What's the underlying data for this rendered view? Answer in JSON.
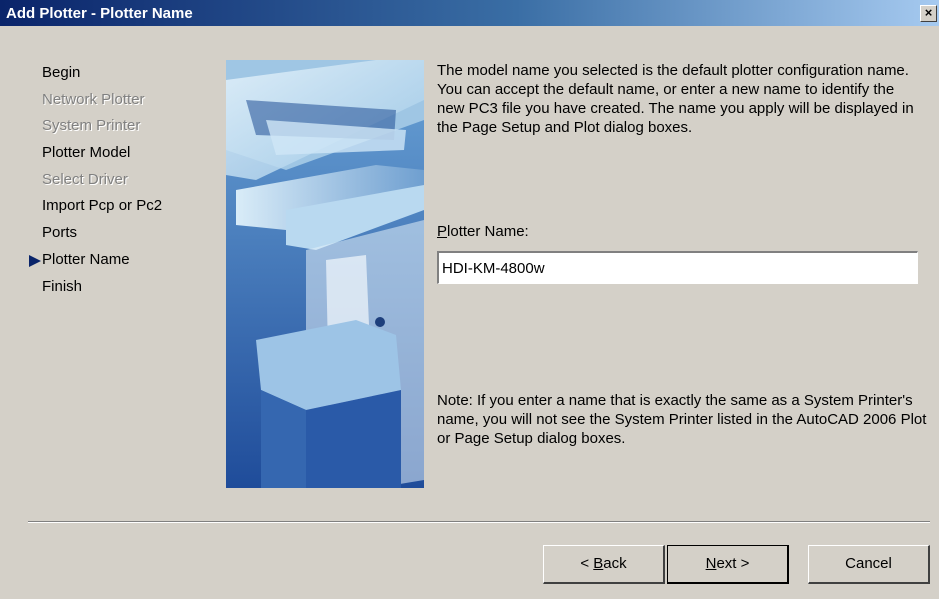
{
  "window": {
    "title": "Add Plotter - Plotter Name",
    "close_label": "×"
  },
  "steps": [
    {
      "label": "Begin",
      "state": "enabled"
    },
    {
      "label": "Network Plotter",
      "state": "disabled"
    },
    {
      "label": "System Printer",
      "state": "disabled"
    },
    {
      "label": "Plotter Model",
      "state": "enabled"
    },
    {
      "label": "Select Driver",
      "state": "disabled"
    },
    {
      "label": "Import Pcp or Pc2",
      "state": "enabled"
    },
    {
      "label": "Ports",
      "state": "enabled"
    },
    {
      "label": "Plotter Name",
      "state": "current"
    },
    {
      "label": "Finish",
      "state": "enabled"
    }
  ],
  "main": {
    "description": "The model name you selected is the default plotter configuration name. You can accept the default name, or enter a new name to identify the new PC3 file you have created. The name you apply will be displayed in the Page Setup and Plot dialog boxes.",
    "field_label_mnemonic": "P",
    "field_label_rest": "lotter Name:",
    "field_value": "HDI-KM-4800w",
    "note": "Note: If you enter a name that is exactly the same as a System Printer's name, you will not see the System Printer listed in the AutoCAD 2006 Plot or Page Setup dialog boxes."
  },
  "buttons": {
    "back_prefix": "< ",
    "back_mnemonic": "B",
    "back_rest": "ack",
    "next_mnemonic": "N",
    "next_rest": "ext >",
    "cancel_label": "Cancel"
  },
  "colors": {
    "titlebar_start": "#0a246a",
    "titlebar_end": "#a6caf0",
    "dialog_bg": "#d4d0c8",
    "step_arrow": "#0a246a",
    "disabled_text": "#808080"
  },
  "icons": {
    "current_step": "right-arrow-icon",
    "close": "close-icon"
  }
}
